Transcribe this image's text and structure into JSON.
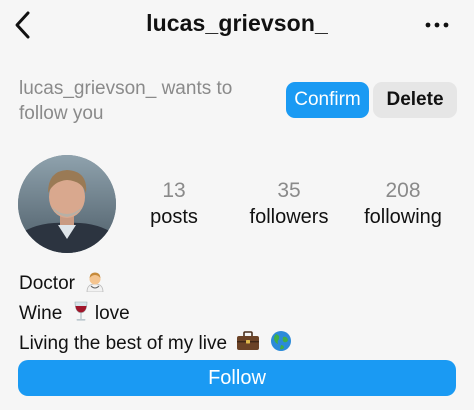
{
  "header": {
    "title": "lucas_grievson_",
    "back_icon": "chevron-left-icon",
    "more_icon": "more-horizontal-icon"
  },
  "follow_request": {
    "text": "lucas_grievson_ wants to follow you",
    "confirm_label": "Confirm",
    "delete_label": "Delete"
  },
  "stats": {
    "posts": {
      "count": "13",
      "label": "posts"
    },
    "followers": {
      "count": "35",
      "label": "followers"
    },
    "following": {
      "count": "208",
      "label": "following"
    }
  },
  "bio": {
    "line1": "Doctor",
    "line2_a": "Wine",
    "line2_b": "love",
    "line3": "Living the best of my live"
  },
  "follow_button_label": "Follow",
  "colors": {
    "primary_blue": "#1a9af3",
    "secondary_gray": "#e6e6e6",
    "muted_text": "#8a8a8a"
  }
}
